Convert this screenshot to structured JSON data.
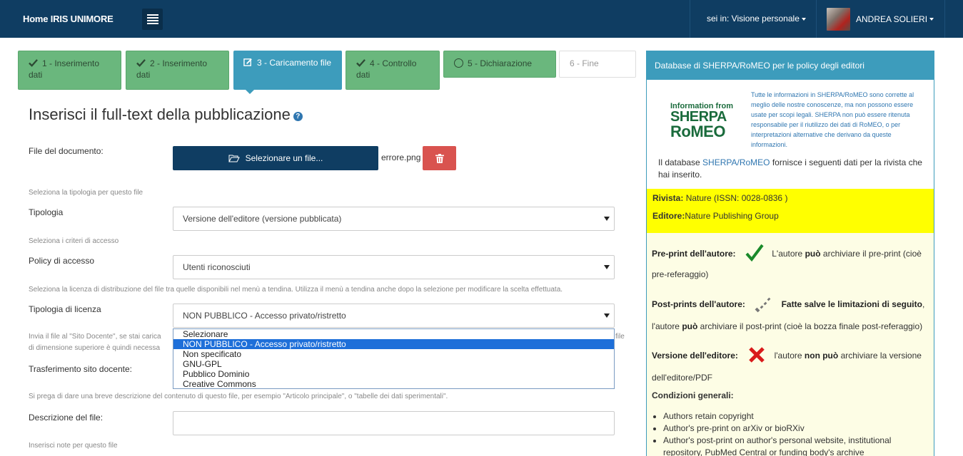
{
  "nav": {
    "brand": "Home IRIS UNIMORE",
    "view_selector": "sei in: Visione personale",
    "user_name": "ANDREA SOLIERI"
  },
  "steps": [
    {
      "label": "1 - Inserimento dati",
      "state": "done"
    },
    {
      "label": "2 - Inserimento dati",
      "state": "done"
    },
    {
      "label": "3 - Caricamento file",
      "state": "active"
    },
    {
      "label": "4 - Controllo dati",
      "state": "done"
    },
    {
      "label": "5 - Dichiarazione",
      "state": "done"
    },
    {
      "label": "6 - Fine",
      "state": "todo"
    }
  ],
  "form": {
    "title": "Inserisci il full-text della pubblicazione",
    "file_label": "File del documento:",
    "file_button": "Selezionare un file...",
    "file_name": "errore.png",
    "tipologia_hint": "Seleziona la tipologia per questo file",
    "tipologia_label": "Tipologia",
    "tipologia_value": "Versione dell'editore (versione pubblicata)",
    "access_hint": "Seleziona i criteri di accesso",
    "access_label": "Policy di accesso",
    "access_value": "Utenti riconosciuti",
    "license_hint": "Seleziona la licenza di distribuzione del file tra quelle disponibili nel menù a tendina. Utilizza il menù a tendina anche dopo la selezione per modificare la scelta effettuata.",
    "license_label": "Tipologia di licenza",
    "license_value": "NON PUBBLICO - Accesso privato/ristretto",
    "license_options": [
      "Selezionare",
      "NON PUBBLICO - Accesso privato/ristretto",
      "Non specificato",
      "GNU-GPL",
      "Pubblico Dominio",
      "Creative Commons"
    ],
    "license_selected_index": 1,
    "docente_hint_left": "Invia il file al \"Sito Docente\", se stai carica",
    "docente_hint_left2": "di dimensione superiore è quindi necessa",
    "docente_hint_right": "file",
    "docente_label": "Trasferimento sito docente:",
    "desc_hint": "Si prega di dare una breve descrizione del contenuto di questo file, per esempio \"Articolo principale\", o \"tabelle dei dati sperimentali\".",
    "desc_label": "Descrizione del file:",
    "notes_hint": "Inserisci note per questo file"
  },
  "panel": {
    "header": "Database di SHERPA/RoMEO per le policy degli editori",
    "logo_small": "Information from",
    "logo_big1": "SHERPA",
    "logo_big2": "RoMEO",
    "disclaimer": "Tutte le informazioni in SHERPA/RoMEO sono corrette al meglio delle nostre conoscenze, ma non possono essere usate per scopi legali. SHERPA non può essere ritenuta responsabile per il riutilizzo dei dati di RoMEO, o per interpretazioni alternative che derivano da queste informazioni.",
    "intro_pre": "Il database ",
    "intro_link": "SHERPA/RoMEO",
    "intro_post": " fornisce i seguenti dati per la rivista che hai inserito.",
    "rivista_label": "Rivista:",
    "rivista_value": " Nature (ISSN: 0028-0836 )",
    "editore_label": "Editore:",
    "editore_value": "Nature Publishing Group",
    "preprint_label": "Pre-print dell'autore:",
    "preprint_text_pre": "L'autore ",
    "preprint_text_bold": "può",
    "preprint_text_post": " archiviare il pre-print (cioè",
    "preprint_text_line2": "pre-referaggio)",
    "postprint_label": "Post-prints dell'autore:",
    "postprint_bold": "Fatte salve le limitazioni di seguito",
    "postprint_line2_pre": "l'autore ",
    "postprint_line2_bold": "può",
    "postprint_line2_post": " archiviare il post-print (cioè la bozza finale post-referaggio)",
    "version_label": "Versione dell'editore:",
    "version_text_pre": "l'autore ",
    "version_text_bold": "non può",
    "version_text_post": " archiviare la versione",
    "version_line2": "dell'editore/PDF",
    "conditions_label": "Condizioni generali:",
    "conditions": [
      "Authors retain copyright",
      "Author's pre-print on arXiv or bioRXiv",
      "Author's post-print on author's personal website, institutional repository, PubMed Central or funding body's archive"
    ]
  },
  "colors": {
    "nav_bg": "#0f3d62",
    "step_done": "#6ab77d",
    "step_active": "#3d9cbc",
    "delete_btn": "#d9534f",
    "highlight": "#ffff00"
  }
}
